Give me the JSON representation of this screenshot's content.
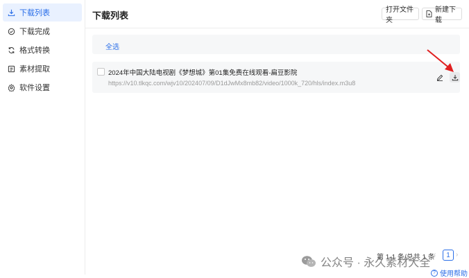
{
  "sidebar": {
    "items": [
      {
        "label": "下载列表",
        "icon": "download-icon",
        "active": true
      },
      {
        "label": "下载完成",
        "icon": "check-circle-icon",
        "active": false
      },
      {
        "label": "格式转换",
        "icon": "refresh-icon",
        "active": false
      },
      {
        "label": "素材提取",
        "icon": "extract-icon",
        "active": false
      },
      {
        "label": "软件设置",
        "icon": "gear-icon",
        "active": false
      }
    ]
  },
  "header": {
    "title": "下载列表",
    "open_folder_label": "打开文件夹",
    "new_download_label": "新建下载"
  },
  "list": {
    "select_all_label": "全选",
    "tasks": [
      {
        "title": "2024年中国大陆电视剧《梦想城》第01集免费在线观看-扁豆影院",
        "url": "https://v10.tlkqc.com/wjv10/202407/09/D1dJwMx8mb82/video/1000k_720/hls/index.m3u8"
      }
    ]
  },
  "pagination": {
    "summary": "第 1-1 条/总共 1 条",
    "prev": "‹",
    "current": "1",
    "next": "›"
  },
  "help": {
    "label": "使用帮助"
  },
  "watermark": {
    "text": "公众号 · 永久素材大全"
  },
  "colors": {
    "accent": "#2a6ee8",
    "arrow": "#e02020"
  }
}
